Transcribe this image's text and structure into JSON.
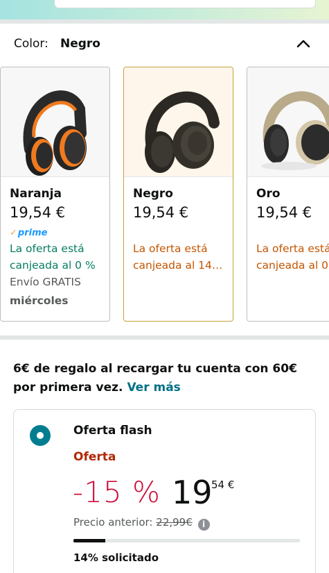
{
  "color_selector": {
    "label": "Color:",
    "selected": "Negro"
  },
  "swatches": [
    {
      "name": "Naranja",
      "price": "19,54 €",
      "prime": "prime",
      "offer_line1": "La oferta está",
      "offer_line2": "canjeada al 0 %",
      "shipping": "Envío GRATIS",
      "delivery_day": "miércoles",
      "band_color": "#f07a1f"
    },
    {
      "name": "Negro",
      "price": "19,54 €",
      "offer_line1": "La oferta está",
      "offer_line2": "canjeada al 14…",
      "band_color": "#3a3630"
    },
    {
      "name": "Oro",
      "price": "19,54 €",
      "offer_line1": "La oferta está",
      "offer_line2": "canjeada al 0",
      "band_color": "#c9b894"
    }
  ],
  "promo": {
    "text": "6€ de regalo al recargar tu cuenta con 60€ por primera vez.",
    "link": "Ver más"
  },
  "deal": {
    "title": "Oferta flash",
    "badge": "Oferta",
    "discount": "-15 %",
    "price_whole": "19",
    "price_fraction": "54 €",
    "previous_label": "Precio anterior:",
    "previous_price": "22,99€",
    "claimed_fraction": 0.14,
    "claimed_text": "14% solicitado"
  },
  "colors": {
    "accent_teal": "#017d8f",
    "deal_red": "#cc0c39",
    "offer_green": "#067d62",
    "offer_orange": "#c45500",
    "link_blue": "#007185"
  }
}
